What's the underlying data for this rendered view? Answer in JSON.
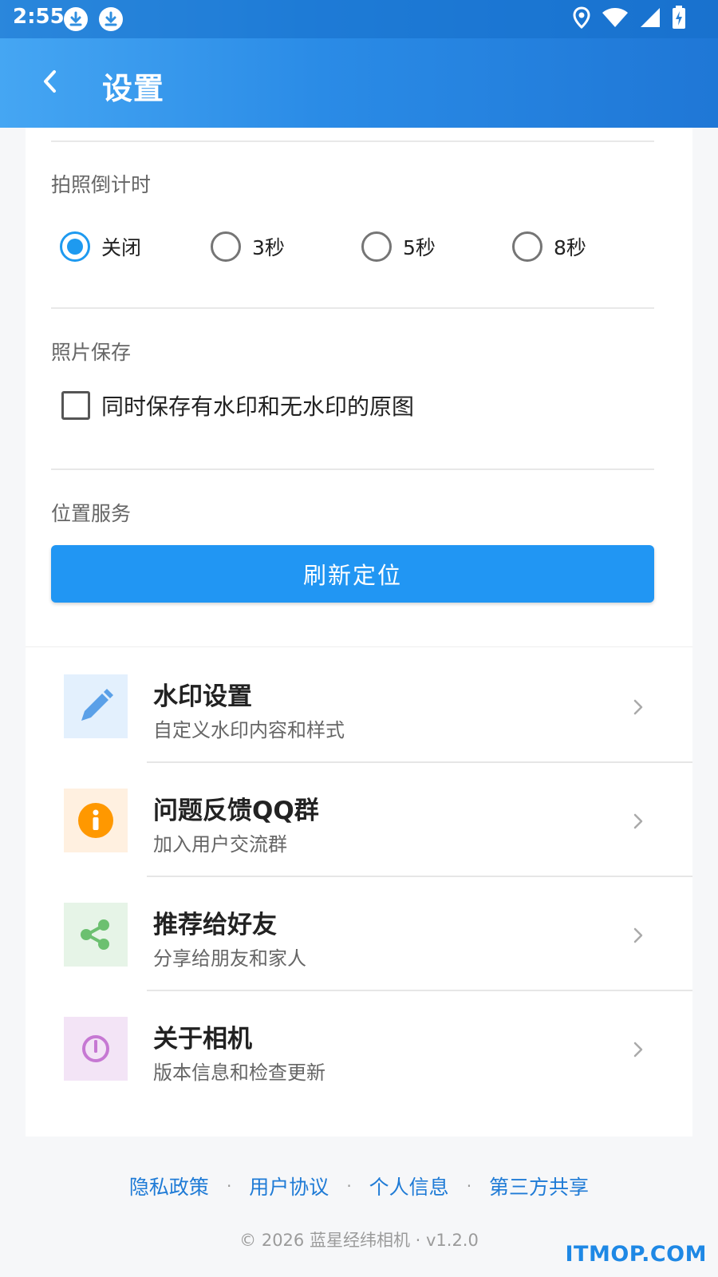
{
  "status_bar": {
    "time": "2:55",
    "icons": [
      "download-icon",
      "download-icon",
      "location-icon",
      "wifi-icon",
      "signal-icon",
      "battery-charging-icon"
    ]
  },
  "app_bar": {
    "title": "设置",
    "back_icon": "chevron-left-icon"
  },
  "countdown": {
    "title": "拍照倒计时",
    "options": [
      {
        "label": "关闭",
        "checked": true
      },
      {
        "label": "3秒",
        "checked": false
      },
      {
        "label": "5秒",
        "checked": false
      },
      {
        "label": "8秒",
        "checked": false
      }
    ]
  },
  "photo_save": {
    "title": "照片保存",
    "checkbox_label": "同时保存有水印和无水印的原图",
    "checked": false
  },
  "location": {
    "title": "位置服务",
    "button_label": "刷新定位"
  },
  "menu": [
    {
      "title": "水印设置",
      "subtitle": "自定义水印内容和样式",
      "icon": "pencil-icon",
      "icon_bg": "#e3f0fd",
      "icon_color": "#5aa0e8"
    },
    {
      "title": "问题反馈QQ群",
      "subtitle": "加入用户交流群",
      "icon": "info-icon",
      "icon_bg": "#fff0e0",
      "icon_color": "#ff9800"
    },
    {
      "title": "推荐给好友",
      "subtitle": "分享给朋友和家人",
      "icon": "share-icon",
      "icon_bg": "#e6f4e7",
      "icon_color": "#6cc070"
    },
    {
      "title": "关于相机",
      "subtitle": "版本信息和检查更新",
      "icon": "power-icon",
      "icon_bg": "#f3e4f6",
      "icon_color": "#c678d3"
    }
  ],
  "footer": {
    "links": [
      "隐私政策",
      "用户协议",
      "个人信息",
      "第三方共享"
    ],
    "separator": "·",
    "copyright": "© 2026 蓝星经纬相机 · v1.2.0"
  },
  "watermark": "ITMOP.COM"
}
